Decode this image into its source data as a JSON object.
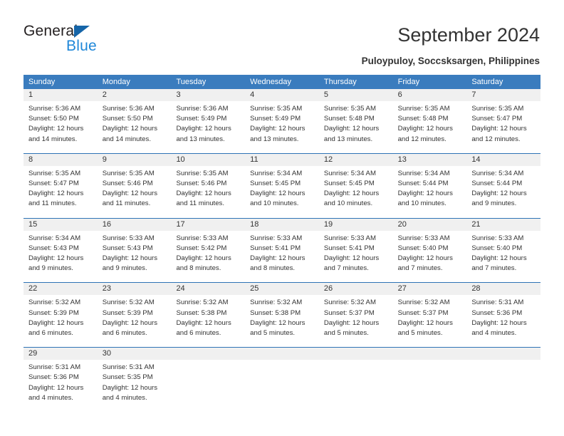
{
  "brand": {
    "name_part1": "General",
    "name_part2": "Blue",
    "triangle_icon": "triangle-icon"
  },
  "header": {
    "title": "September 2024",
    "subtitle": "Puloypuloy, Soccsksargen, Philippines"
  },
  "colors": {
    "header_blue": "#3a7cbe",
    "row_rule_blue": "#2e73b5",
    "day_strip_gray": "#f0f0f0",
    "logo_blue": "#1f87d8",
    "logo_triangle_blue": "#1565a8"
  },
  "calendar": {
    "weekdays": [
      "Sunday",
      "Monday",
      "Tuesday",
      "Wednesday",
      "Thursday",
      "Friday",
      "Saturday"
    ],
    "labels": {
      "sunrise": "Sunrise:",
      "sunset": "Sunset:",
      "daylight": "Daylight:"
    },
    "weeks": [
      [
        {
          "day": "1",
          "sunrise": "Sunrise: 5:36 AM",
          "sunset": "Sunset: 5:50 PM",
          "daylight_line1": "Daylight: 12 hours",
          "daylight_line2": "and 14 minutes."
        },
        {
          "day": "2",
          "sunrise": "Sunrise: 5:36 AM",
          "sunset": "Sunset: 5:50 PM",
          "daylight_line1": "Daylight: 12 hours",
          "daylight_line2": "and 14 minutes."
        },
        {
          "day": "3",
          "sunrise": "Sunrise: 5:36 AM",
          "sunset": "Sunset: 5:49 PM",
          "daylight_line1": "Daylight: 12 hours",
          "daylight_line2": "and 13 minutes."
        },
        {
          "day": "4",
          "sunrise": "Sunrise: 5:35 AM",
          "sunset": "Sunset: 5:49 PM",
          "daylight_line1": "Daylight: 12 hours",
          "daylight_line2": "and 13 minutes."
        },
        {
          "day": "5",
          "sunrise": "Sunrise: 5:35 AM",
          "sunset": "Sunset: 5:48 PM",
          "daylight_line1": "Daylight: 12 hours",
          "daylight_line2": "and 13 minutes."
        },
        {
          "day": "6",
          "sunrise": "Sunrise: 5:35 AM",
          "sunset": "Sunset: 5:48 PM",
          "daylight_line1": "Daylight: 12 hours",
          "daylight_line2": "and 12 minutes."
        },
        {
          "day": "7",
          "sunrise": "Sunrise: 5:35 AM",
          "sunset": "Sunset: 5:47 PM",
          "daylight_line1": "Daylight: 12 hours",
          "daylight_line2": "and 12 minutes."
        }
      ],
      [
        {
          "day": "8",
          "sunrise": "Sunrise: 5:35 AM",
          "sunset": "Sunset: 5:47 PM",
          "daylight_line1": "Daylight: 12 hours",
          "daylight_line2": "and 11 minutes."
        },
        {
          "day": "9",
          "sunrise": "Sunrise: 5:35 AM",
          "sunset": "Sunset: 5:46 PM",
          "daylight_line1": "Daylight: 12 hours",
          "daylight_line2": "and 11 minutes."
        },
        {
          "day": "10",
          "sunrise": "Sunrise: 5:35 AM",
          "sunset": "Sunset: 5:46 PM",
          "daylight_line1": "Daylight: 12 hours",
          "daylight_line2": "and 11 minutes."
        },
        {
          "day": "11",
          "sunrise": "Sunrise: 5:34 AM",
          "sunset": "Sunset: 5:45 PM",
          "daylight_line1": "Daylight: 12 hours",
          "daylight_line2": "and 10 minutes."
        },
        {
          "day": "12",
          "sunrise": "Sunrise: 5:34 AM",
          "sunset": "Sunset: 5:45 PM",
          "daylight_line1": "Daylight: 12 hours",
          "daylight_line2": "and 10 minutes."
        },
        {
          "day": "13",
          "sunrise": "Sunrise: 5:34 AM",
          "sunset": "Sunset: 5:44 PM",
          "daylight_line1": "Daylight: 12 hours",
          "daylight_line2": "and 10 minutes."
        },
        {
          "day": "14",
          "sunrise": "Sunrise: 5:34 AM",
          "sunset": "Sunset: 5:44 PM",
          "daylight_line1": "Daylight: 12 hours",
          "daylight_line2": "and 9 minutes."
        }
      ],
      [
        {
          "day": "15",
          "sunrise": "Sunrise: 5:34 AM",
          "sunset": "Sunset: 5:43 PM",
          "daylight_line1": "Daylight: 12 hours",
          "daylight_line2": "and 9 minutes."
        },
        {
          "day": "16",
          "sunrise": "Sunrise: 5:33 AM",
          "sunset": "Sunset: 5:43 PM",
          "daylight_line1": "Daylight: 12 hours",
          "daylight_line2": "and 9 minutes."
        },
        {
          "day": "17",
          "sunrise": "Sunrise: 5:33 AM",
          "sunset": "Sunset: 5:42 PM",
          "daylight_line1": "Daylight: 12 hours",
          "daylight_line2": "and 8 minutes."
        },
        {
          "day": "18",
          "sunrise": "Sunrise: 5:33 AM",
          "sunset": "Sunset: 5:41 PM",
          "daylight_line1": "Daylight: 12 hours",
          "daylight_line2": "and 8 minutes."
        },
        {
          "day": "19",
          "sunrise": "Sunrise: 5:33 AM",
          "sunset": "Sunset: 5:41 PM",
          "daylight_line1": "Daylight: 12 hours",
          "daylight_line2": "and 7 minutes."
        },
        {
          "day": "20",
          "sunrise": "Sunrise: 5:33 AM",
          "sunset": "Sunset: 5:40 PM",
          "daylight_line1": "Daylight: 12 hours",
          "daylight_line2": "and 7 minutes."
        },
        {
          "day": "21",
          "sunrise": "Sunrise: 5:33 AM",
          "sunset": "Sunset: 5:40 PM",
          "daylight_line1": "Daylight: 12 hours",
          "daylight_line2": "and 7 minutes."
        }
      ],
      [
        {
          "day": "22",
          "sunrise": "Sunrise: 5:32 AM",
          "sunset": "Sunset: 5:39 PM",
          "daylight_line1": "Daylight: 12 hours",
          "daylight_line2": "and 6 minutes."
        },
        {
          "day": "23",
          "sunrise": "Sunrise: 5:32 AM",
          "sunset": "Sunset: 5:39 PM",
          "daylight_line1": "Daylight: 12 hours",
          "daylight_line2": "and 6 minutes."
        },
        {
          "day": "24",
          "sunrise": "Sunrise: 5:32 AM",
          "sunset": "Sunset: 5:38 PM",
          "daylight_line1": "Daylight: 12 hours",
          "daylight_line2": "and 6 minutes."
        },
        {
          "day": "25",
          "sunrise": "Sunrise: 5:32 AM",
          "sunset": "Sunset: 5:38 PM",
          "daylight_line1": "Daylight: 12 hours",
          "daylight_line2": "and 5 minutes."
        },
        {
          "day": "26",
          "sunrise": "Sunrise: 5:32 AM",
          "sunset": "Sunset: 5:37 PM",
          "daylight_line1": "Daylight: 12 hours",
          "daylight_line2": "and 5 minutes."
        },
        {
          "day": "27",
          "sunrise": "Sunrise: 5:32 AM",
          "sunset": "Sunset: 5:37 PM",
          "daylight_line1": "Daylight: 12 hours",
          "daylight_line2": "and 5 minutes."
        },
        {
          "day": "28",
          "sunrise": "Sunrise: 5:31 AM",
          "sunset": "Sunset: 5:36 PM",
          "daylight_line1": "Daylight: 12 hours",
          "daylight_line2": "and 4 minutes."
        }
      ],
      [
        {
          "day": "29",
          "sunrise": "Sunrise: 5:31 AM",
          "sunset": "Sunset: 5:36 PM",
          "daylight_line1": "Daylight: 12 hours",
          "daylight_line2": "and 4 minutes."
        },
        {
          "day": "30",
          "sunrise": "Sunrise: 5:31 AM",
          "sunset": "Sunset: 5:35 PM",
          "daylight_line1": "Daylight: 12 hours",
          "daylight_line2": "and 4 minutes."
        },
        {
          "day": "",
          "sunrise": "",
          "sunset": "",
          "daylight_line1": "",
          "daylight_line2": ""
        },
        {
          "day": "",
          "sunrise": "",
          "sunset": "",
          "daylight_line1": "",
          "daylight_line2": ""
        },
        {
          "day": "",
          "sunrise": "",
          "sunset": "",
          "daylight_line1": "",
          "daylight_line2": ""
        },
        {
          "day": "",
          "sunrise": "",
          "sunset": "",
          "daylight_line1": "",
          "daylight_line2": ""
        },
        {
          "day": "",
          "sunrise": "",
          "sunset": "",
          "daylight_line1": "",
          "daylight_line2": ""
        }
      ]
    ]
  }
}
